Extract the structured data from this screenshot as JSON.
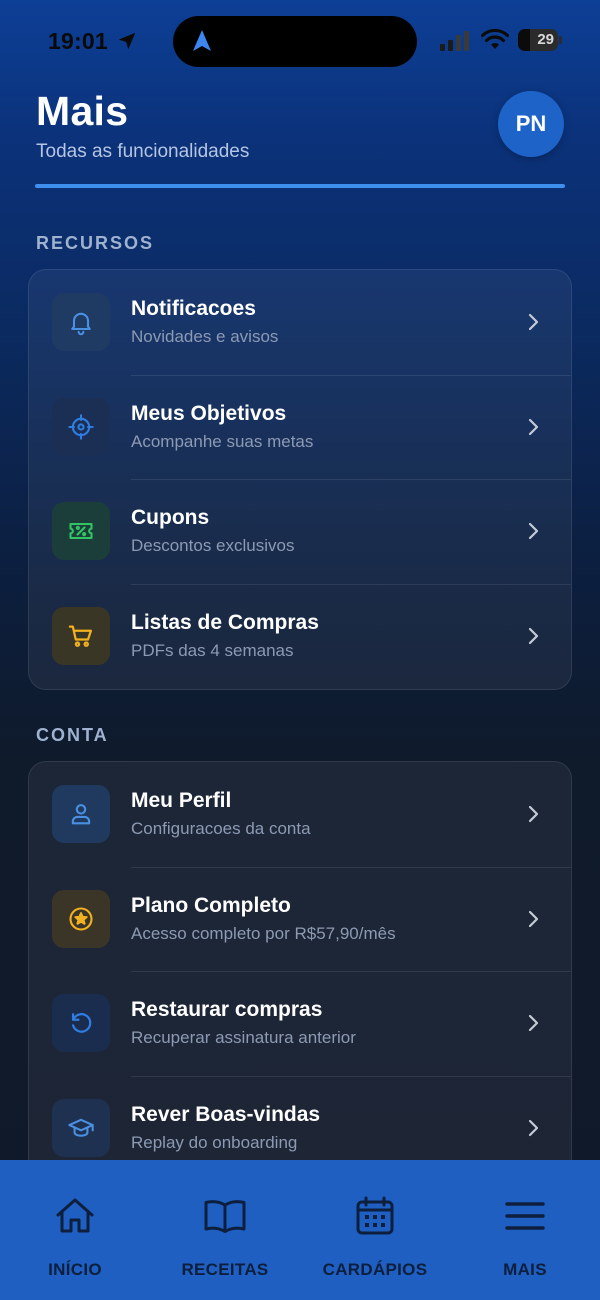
{
  "status_bar": {
    "time": "19:01",
    "battery_level": "29",
    "battery_fraction": 0.29,
    "icons": [
      "location-arrow-icon",
      "navigation-icon",
      "signal-icon",
      "wifi-icon",
      "battery-icon"
    ]
  },
  "header": {
    "title": "Mais",
    "subtitle": "Todas as funcionalidades",
    "avatar_initials": "PN",
    "accent_color": "#3f8fef"
  },
  "sections": [
    {
      "label": "RECURSOS",
      "items": [
        {
          "title": "Notificacoes",
          "subtitle": "Novidades e avisos",
          "icon": "bell-icon",
          "color": "#4a90e2"
        },
        {
          "title": "Meus Objetivos",
          "subtitle": "Acompanhe suas metas",
          "icon": "target-icon",
          "color": "#2f7de0"
        },
        {
          "title": "Cupons",
          "subtitle": "Descontos exclusivos",
          "icon": "coupon-icon",
          "color": "#30c463"
        },
        {
          "title": "Listas de Compras",
          "subtitle": "PDFs das 4 semanas",
          "icon": "cart-icon",
          "color": "#f2b120"
        }
      ]
    },
    {
      "label": "CONTA",
      "items": [
        {
          "title": "Meu Perfil",
          "subtitle": "Configuracoes da conta",
          "icon": "user-icon",
          "color": "#4a90e2"
        },
        {
          "title": "Plano Completo",
          "subtitle": "Acesso completo por R$57,90/mês",
          "icon": "star-icon",
          "color": "#f2b120"
        },
        {
          "title": "Restaurar compras",
          "subtitle": "Recuperar assinatura anterior",
          "icon": "restore-icon",
          "color": "#2f7de0"
        },
        {
          "title": "Rever Boas-vindas",
          "subtitle": "Replay do onboarding",
          "icon": "graduation-cap-icon",
          "color": "#4a90e2"
        }
      ]
    }
  ],
  "bottom_nav": {
    "items": [
      {
        "label": "INÍCIO",
        "icon": "home-icon"
      },
      {
        "label": "RECEITAS",
        "icon": "book-icon"
      },
      {
        "label": "CARDÁPIOS",
        "icon": "calendar-icon"
      },
      {
        "label": "MAIS",
        "icon": "menu-icon"
      }
    ],
    "background": "#1e5fc1",
    "label_color": "#0d1f3d"
  }
}
